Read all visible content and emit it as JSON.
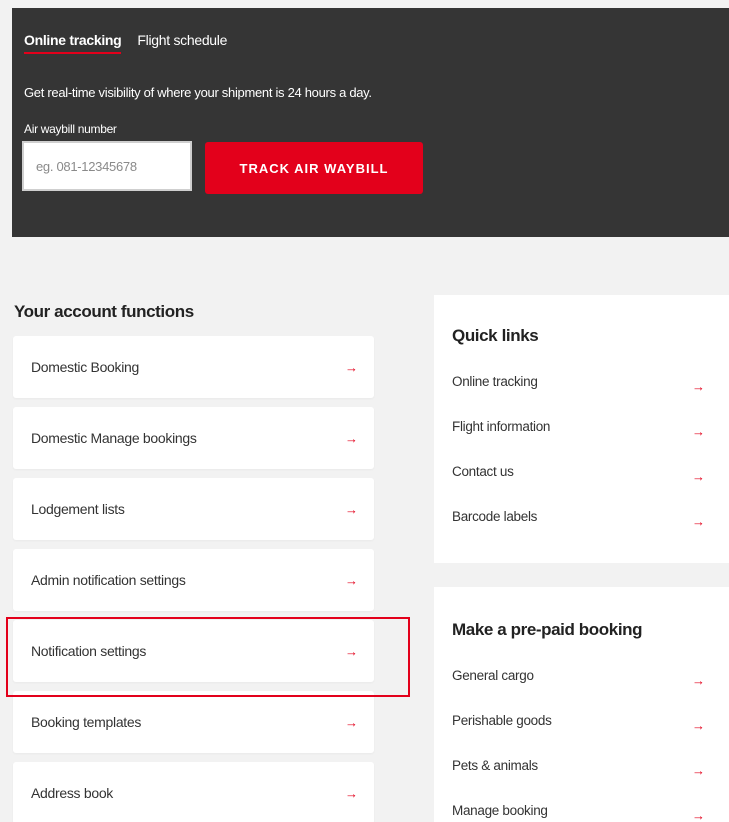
{
  "tracking": {
    "tabs": [
      {
        "label": "Online tracking",
        "active": true
      },
      {
        "label": "Flight schedule",
        "active": false
      }
    ],
    "description": "Get real-time visibility of where your shipment is 24 hours a day.",
    "awb_label": "Air waybill number",
    "awb_placeholder": "eg. 081-12345678",
    "track_button": "TRACK AIR WAYBILL"
  },
  "account_functions": {
    "title": "Your account functions",
    "items": [
      {
        "label": "Domestic Booking"
      },
      {
        "label": "Domestic Manage bookings"
      },
      {
        "label": "Lodgement lists"
      },
      {
        "label": "Admin notification settings"
      },
      {
        "label": "Notification settings"
      },
      {
        "label": "Booking templates"
      },
      {
        "label": "Address book"
      }
    ],
    "highlighted_item": "Notification settings"
  },
  "quick_links": {
    "title": "Quick links",
    "items": [
      {
        "label": "Online tracking"
      },
      {
        "label": "Flight information"
      },
      {
        "label": "Contact us"
      },
      {
        "label": "Barcode labels"
      }
    ]
  },
  "prepaid_booking": {
    "title": "Make a pre-paid booking",
    "items": [
      {
        "label": "General cargo"
      },
      {
        "label": "Perishable goods"
      },
      {
        "label": "Pets & animals"
      },
      {
        "label": "Manage booking"
      }
    ]
  },
  "icons": {
    "arrow": "→",
    "arrow_name": "arrow-right-icon"
  },
  "colors": {
    "accent": "#e3001b",
    "panel_bg": "#353535",
    "page_bg": "#f2f2f2",
    "card_bg": "#ffffff"
  }
}
